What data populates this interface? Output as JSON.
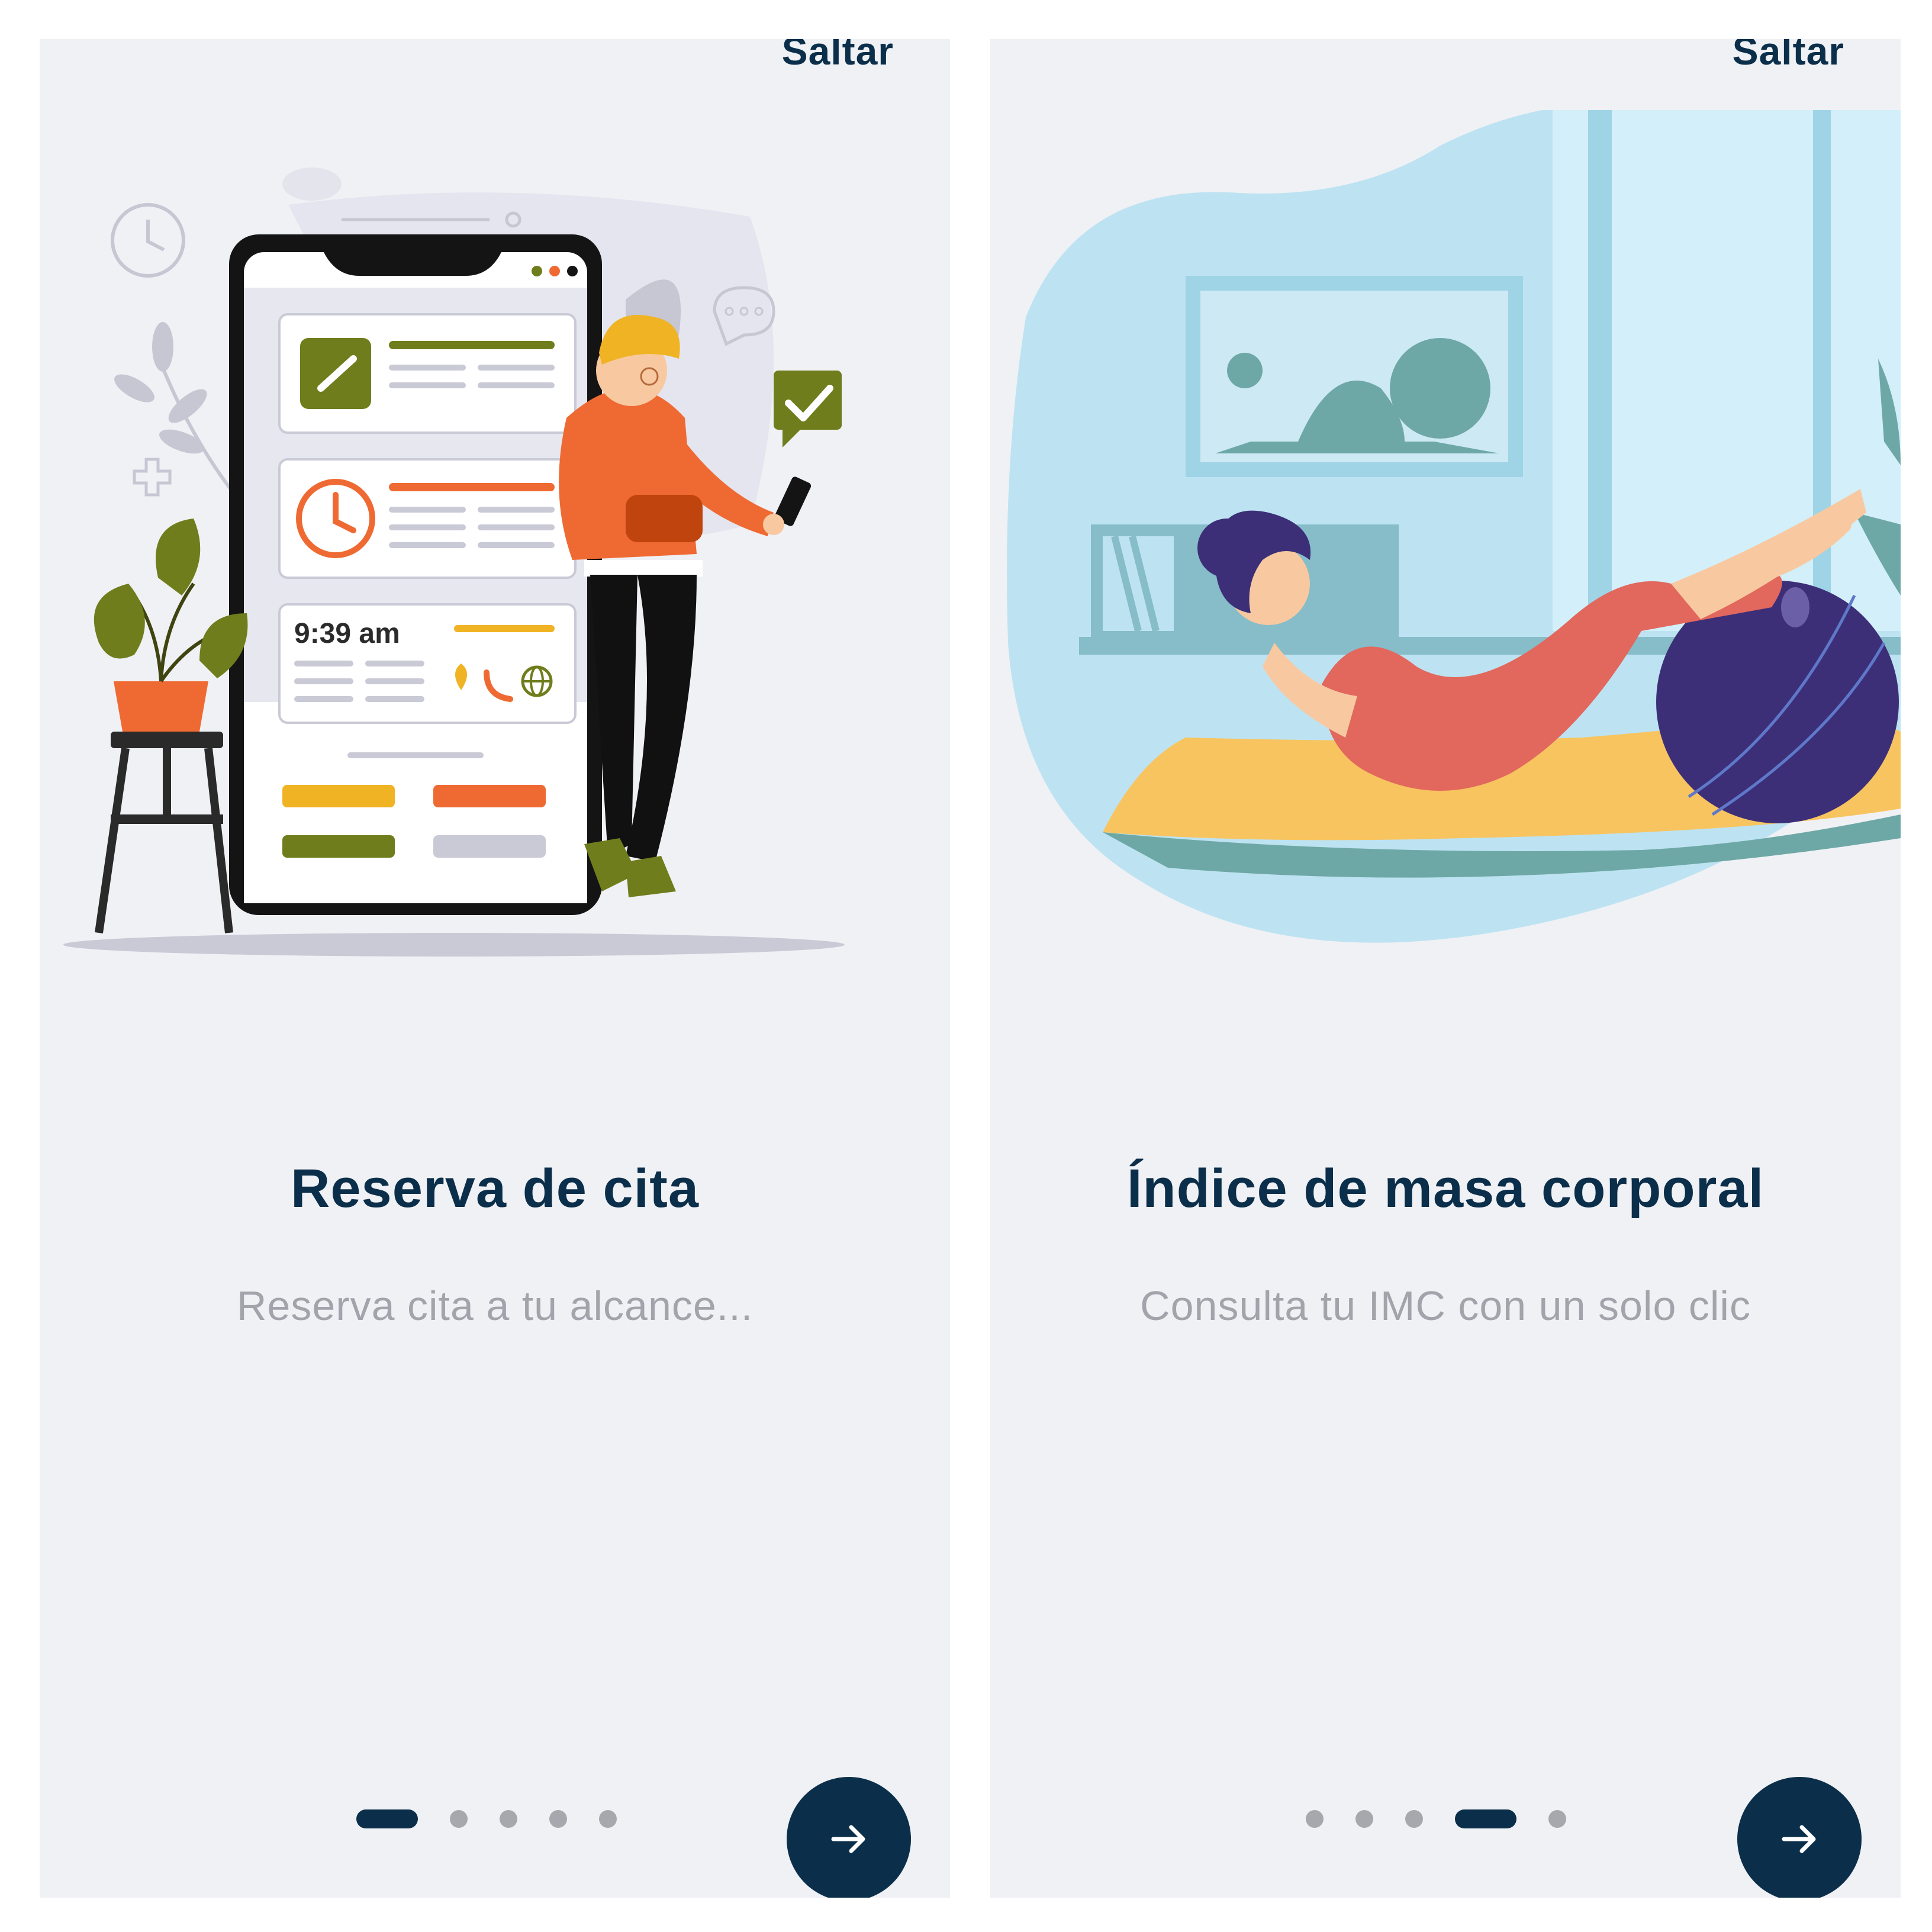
{
  "screens": [
    {
      "skip_label": "Saltar",
      "title": "Reserva de cita",
      "subtitle": "Reserva cita a tu alcance...",
      "illustration_time": "9:39 am",
      "pagination": {
        "total": 5,
        "active": 1
      },
      "next_icon": "arrow-right-icon"
    },
    {
      "skip_label": "Saltar",
      "title": "Índice de masa corporal",
      "subtitle": "Consulta tu IMC con un solo clic",
      "pagination": {
        "total": 5,
        "active": 4
      },
      "next_icon": "arrow-right-icon"
    }
  ],
  "colors": {
    "background": "#f0f1f5",
    "primary": "#0b2f4a",
    "subtitle": "#a3a3ab",
    "dot_inactive": "#a7a8ae",
    "olive": "#6f7d1c",
    "orange": "#ef6a33",
    "yellow": "#f0b323"
  }
}
